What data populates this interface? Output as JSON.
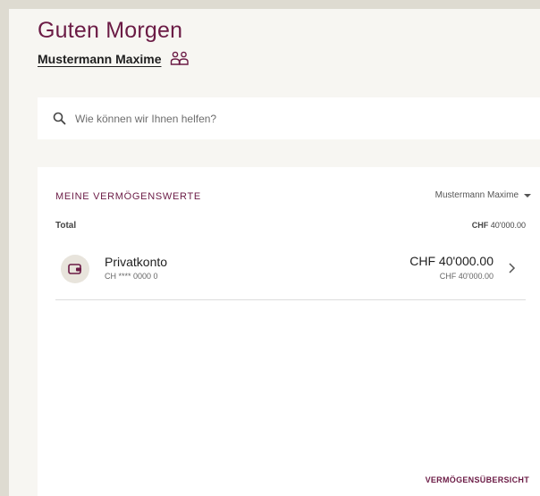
{
  "header": {
    "greeting": "Guten Morgen",
    "user_name": "Mustermann Maxime",
    "user_icon": "users-switch-icon"
  },
  "search": {
    "placeholder": "Wie können wir Ihnen helfen?",
    "value": "",
    "icon": "search-icon"
  },
  "assets": {
    "title": "MEINE VERMÖGENSWERTE",
    "owner_selected": "Mustermann Maxime",
    "total_label": "Total",
    "total_currency": "CHF",
    "total_amount": "40'000.00",
    "accounts": [
      {
        "name": "Privatkonto",
        "iban": "CH **** 0000 0",
        "amount": "CHF 40'000.00",
        "amount_sub": "CHF 40'000.00",
        "icon": "wallet-icon"
      }
    ],
    "overview_link": "VERMÖGENSÜBERSICHT"
  },
  "colors": {
    "accent": "#6b1b45",
    "background": "#dedbd1",
    "panel": "#f7f6f2"
  }
}
